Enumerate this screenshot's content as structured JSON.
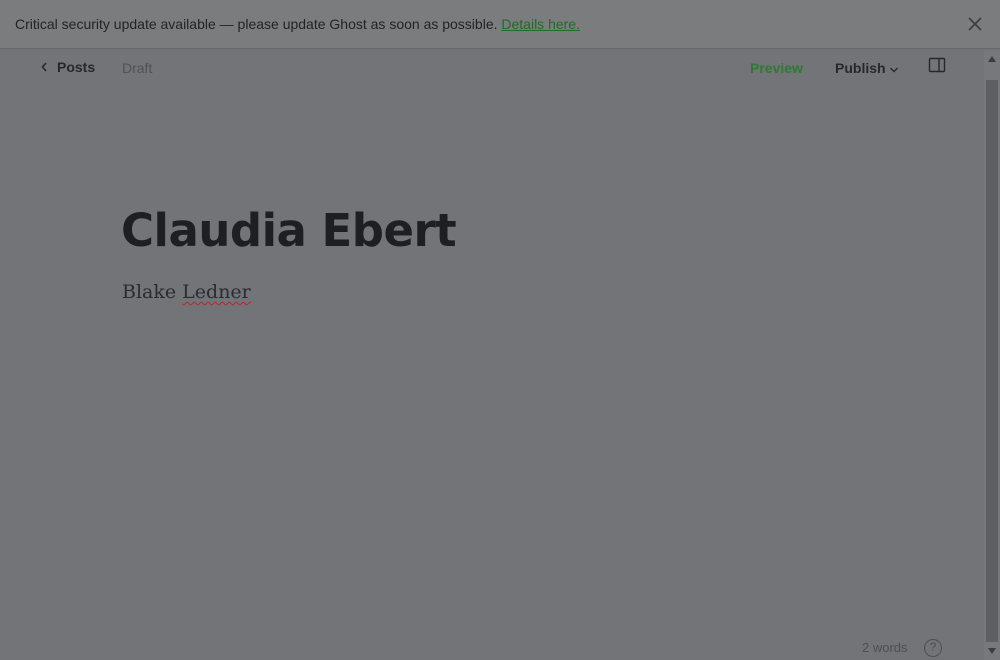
{
  "notification": {
    "message": "Critical security update available — please update Ghost as soon as possible.",
    "link_label": "Details here.",
    "close_icon": "close-icon"
  },
  "header": {
    "back_label": "Posts",
    "back_icon": "chevron-left-icon",
    "status": "Draft",
    "preview_label": "Preview",
    "publish_label": "Publish",
    "publish_icon": "chevron-down-icon",
    "sidebar_icon": "sidebar-toggle-icon"
  },
  "post": {
    "title": "Claudia Ebert",
    "body_first": "Blake ",
    "body_misspelled": "Ledner"
  },
  "footer": {
    "word_count": "2 words",
    "help_label": "?"
  },
  "colors": {
    "accent_green": "#2d7a33",
    "link_green": "#1f6b2a",
    "overlay_bg": "#727477"
  }
}
